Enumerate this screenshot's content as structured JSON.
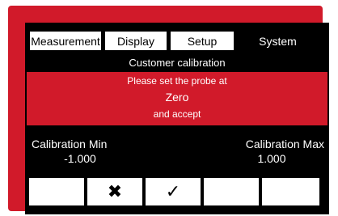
{
  "tabs": [
    {
      "label": "Measurement"
    },
    {
      "label": "Display"
    },
    {
      "label": "Setup"
    },
    {
      "label": "System"
    }
  ],
  "screen_title": "Customer calibration",
  "banner": {
    "line1": "Please set the probe at",
    "line2": "Zero",
    "line3": "and accept"
  },
  "calibration": {
    "min_label": "Calibration Min",
    "min_value": "-1.000",
    "max_label": "Calibration Max",
    "max_value": "1.000"
  },
  "softkeys": {
    "cancel_icon": "✖",
    "accept_icon": "✓"
  },
  "colors": {
    "accent": "#d11a2a",
    "screen_bg": "#000000",
    "key_bg": "#ffffff"
  }
}
